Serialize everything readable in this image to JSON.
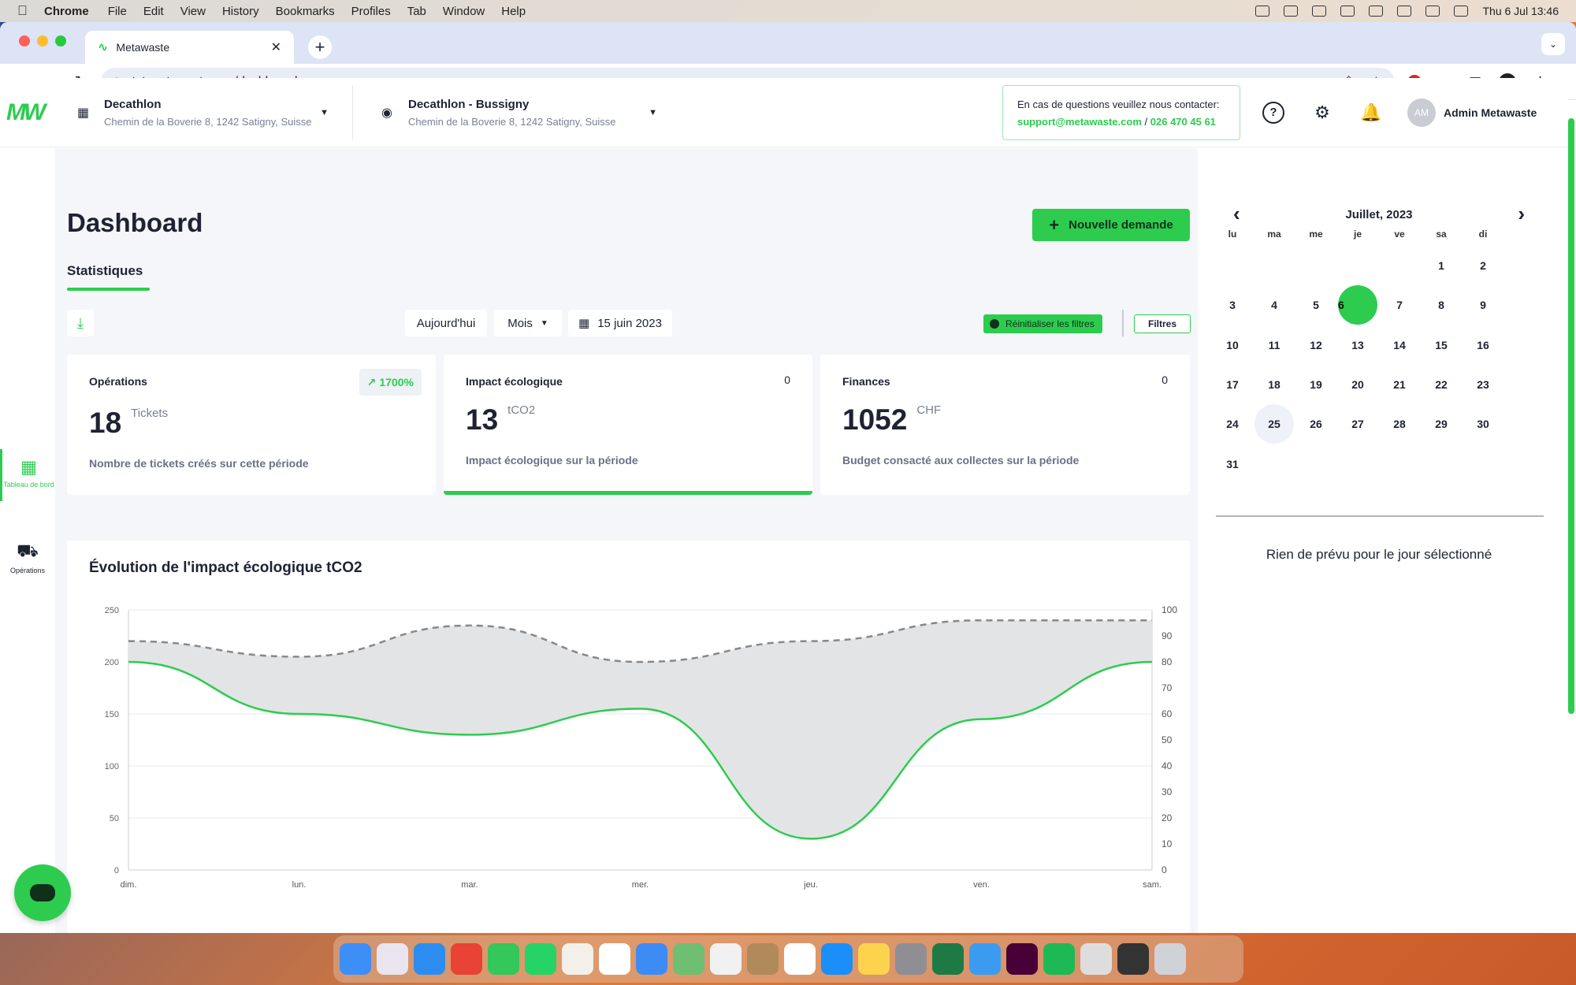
{
  "menubar": {
    "app": "Chrome",
    "items": [
      "File",
      "Edit",
      "View",
      "History",
      "Bookmarks",
      "Profiles",
      "Tab",
      "Window",
      "Help"
    ],
    "clock": "Thu 6 Jul  13:46"
  },
  "browser": {
    "tab_title": "Metawaste",
    "url": "tst.metawaste.app/dashboard"
  },
  "header": {
    "logo": "MW",
    "company": {
      "name": "Decathlon",
      "address": "Chemin de la Boverie 8, 1242 Satigny, Suisse"
    },
    "site": {
      "name": "Decathlon - Bussigny",
      "address": "Chemin de la Boverie 8, 1242 Satigny, Suisse"
    },
    "contact": {
      "line1": "En cas de questions veuillez nous contacter:",
      "email": "support@metawaste.com",
      "separator": "/",
      "phone": "026 470 45 61"
    },
    "user": {
      "initials": "AM",
      "name": "Admin Metawaste"
    }
  },
  "sidebar": {
    "items": [
      {
        "label": "Tableau de bord",
        "icon": "dashboard-icon",
        "active": true
      },
      {
        "label": "Opérations",
        "icon": "truck-icon",
        "active": false
      }
    ]
  },
  "main": {
    "title": "Dashboard",
    "subtab": "Statistiques",
    "new_request": "Nouvelle demande",
    "filters": {
      "today": "Aujourd'hui",
      "period": "Mois",
      "date": "15 juin 2023",
      "reset": "Réinitialiser les filtres",
      "filters": "Filtres"
    },
    "cards": [
      {
        "title": "Opérations",
        "badge": "1700%",
        "value": "18",
        "unit": "Tickets",
        "desc": "Nombre de tickets créés sur cette période"
      },
      {
        "title": "Impact écologique",
        "right": "0",
        "value": "13",
        "unit": "tCO2",
        "desc": "Impact écologique sur la période"
      },
      {
        "title": "Finances",
        "right": "0",
        "value": "1052",
        "unit": "CHF",
        "desc": "Budget consacté aux collectes sur la période"
      }
    ]
  },
  "chart_data": {
    "type": "area",
    "title": "Évolution de l'impact écologique tCO2",
    "categories": [
      "dim.",
      "lun.",
      "mar.",
      "mer.",
      "jeu.",
      "ven.",
      "sam."
    ],
    "y_left": {
      "min": 0,
      "max": 250,
      "ticks": [
        0,
        50,
        100,
        150,
        200,
        250
      ]
    },
    "y_right": {
      "min": 0,
      "max": 100,
      "ticks": [
        0,
        10,
        20,
        30,
        40,
        50,
        60,
        70,
        80,
        90,
        100
      ]
    },
    "series": [
      {
        "values": [
          200,
          150,
          130,
          155,
          30,
          145,
          200
        ],
        "axis": "left",
        "style": "solid",
        "color": "#2dcc4f"
      },
      {
        "values": [
          88,
          82,
          94,
          80,
          88,
          96,
          96
        ],
        "axis": "right",
        "style": "dashed",
        "color": "#888888"
      }
    ],
    "grid": true
  },
  "calendar": {
    "month": "Juillet, 2023",
    "weekdays": [
      "lu",
      "ma",
      "me",
      "je",
      "ve",
      "sa",
      "di"
    ],
    "first_weekday_index": 5,
    "days_in_month": 31,
    "selected": 6,
    "highlighted": 25,
    "empty_message": "Rien de prévu pour le jour sélectionné"
  }
}
